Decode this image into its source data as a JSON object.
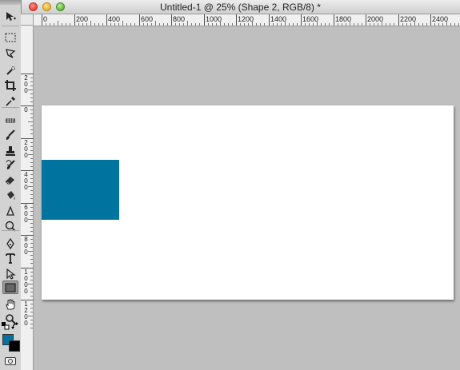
{
  "window": {
    "title": "Untitled-1 @ 25% (Shape 2, RGB/8) *"
  },
  "ruler_top_labels": [
    "0",
    "200",
    "400",
    "600",
    "800",
    "1000",
    "1200",
    "1400",
    "1600",
    "1800",
    "2000",
    "2200",
    "2400"
  ],
  "ruler_left_labels": [
    "2\n0\n0",
    "0",
    "2\n0\n0",
    "4\n0\n0",
    "6\n0\n0",
    "8\n0\n0",
    "1\n0\n0\n0",
    "1\n2\n0\n0"
  ],
  "tools": [
    {
      "name": "move-tool-icon",
      "glyph": "move"
    },
    {
      "name": "marquee-tool-icon",
      "glyph": "marquee"
    },
    {
      "name": "lasso-tool-icon",
      "glyph": "lasso"
    },
    {
      "name": "quick-selection-tool-icon",
      "glyph": "wand"
    },
    {
      "name": "crop-tool-icon",
      "glyph": "crop"
    },
    {
      "name": "eyedropper-tool-icon",
      "glyph": "eyedropper"
    },
    {
      "name": "spot-healing-tool-icon",
      "glyph": "heal"
    },
    {
      "name": "brush-tool-icon",
      "glyph": "brush"
    },
    {
      "name": "clone-stamp-tool-icon",
      "glyph": "stamp"
    },
    {
      "name": "history-brush-tool-icon",
      "glyph": "history"
    },
    {
      "name": "eraser-tool-icon",
      "glyph": "eraser"
    },
    {
      "name": "paint-bucket-tool-icon",
      "glyph": "bucket"
    },
    {
      "name": "blur-tool-icon",
      "glyph": "blur"
    },
    {
      "name": "dodge-tool-icon",
      "glyph": "dodge"
    },
    {
      "name": "pen-tool-icon",
      "glyph": "pen"
    },
    {
      "name": "type-tool-icon",
      "glyph": "type"
    },
    {
      "name": "path-selection-tool-icon",
      "glyph": "path"
    },
    {
      "name": "rectangle-tool-icon",
      "glyph": "rect"
    },
    {
      "name": "hand-tool-icon",
      "glyph": "hand"
    },
    {
      "name": "zoom-tool-icon",
      "glyph": "zoom"
    }
  ],
  "active_tool": "rectangle-tool-icon",
  "colors": {
    "foreground": "#00739e",
    "background": "#000000",
    "shape_fill": "#00739e",
    "canvas": "#ffffff",
    "workspace": "#bfbfbf"
  }
}
